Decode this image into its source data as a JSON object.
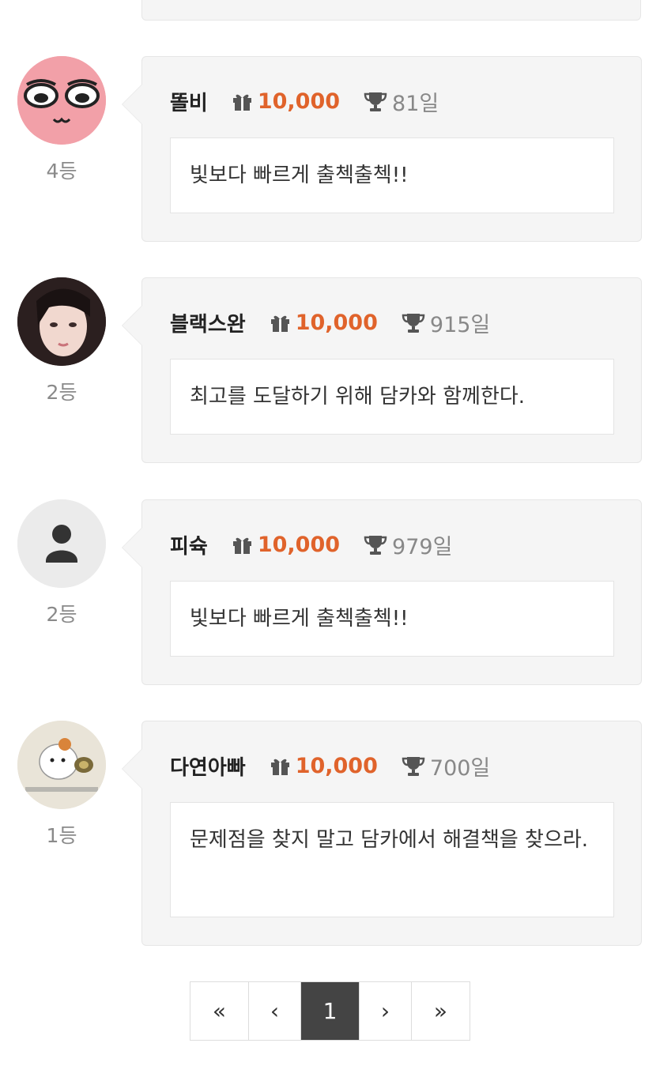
{
  "entries": [
    {
      "rank": "4등",
      "username": "똘비",
      "points": "10,000",
      "days": "81일",
      "message": "빛보다 빠르게 출첵출첵!!",
      "avatar": "pink-cartoon-face"
    },
    {
      "rank": "2등",
      "username": "블랙스완",
      "points": "10,000",
      "days": "915일",
      "message": "최고를 도달하기 위해 담카와 함께한다.",
      "avatar": "portrait-photo"
    },
    {
      "rank": "2등",
      "username": "피슉",
      "points": "10,000",
      "days": "979일",
      "message": "빛보다 빠르게 출첵출첵!!",
      "avatar": "default-user-icon"
    },
    {
      "rank": "1등",
      "username": "다연아빠",
      "points": "10,000",
      "days": "700일",
      "message": "문제점을 찾지 말고 담카에서 해결책을 찾으라.",
      "avatar": "hamster-cartoon"
    }
  ],
  "pagination": {
    "first": "«",
    "prev": "‹",
    "current": "1",
    "next": "›",
    "last": "»"
  },
  "icons": {
    "points": "gift-icon",
    "days": "trophy-icon"
  },
  "colors": {
    "points": "#e0632b",
    "card_background": "#f5f5f5",
    "active_page": "#444444"
  }
}
